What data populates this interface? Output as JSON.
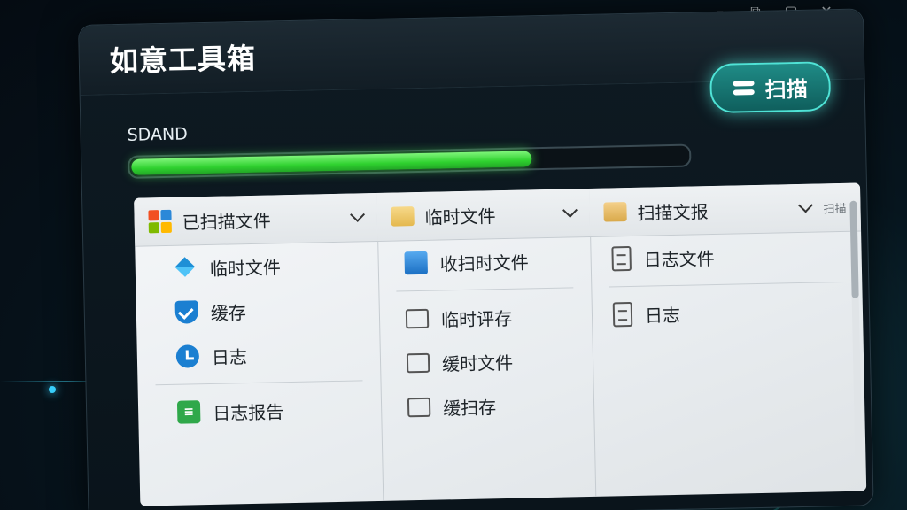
{
  "app": {
    "title": "如意工具箱",
    "scan_button_label": "扫描",
    "drive_label": "SDAND",
    "progress_percent": 72
  },
  "window_controls": [
    "minimize-icon",
    "restore-icon",
    "maximize-icon",
    "close-icon"
  ],
  "columns": [
    {
      "header": "已扫描文件",
      "items": [
        {
          "label": "临时文件",
          "icon": "diamond-icon"
        },
        {
          "label": "缓存",
          "icon": "shield-check-icon"
        },
        {
          "label": "日志",
          "icon": "clock-icon"
        },
        {
          "label": "日志报告",
          "icon": "green-grid-icon"
        }
      ]
    },
    {
      "header": "临时文件",
      "items": [
        {
          "label": "收扫时文件",
          "icon": "blue-folder-icon"
        },
        {
          "label": "临时评存",
          "icon": "folder-outline-icon"
        },
        {
          "label": "缓时文件",
          "icon": "folder-outline-icon"
        },
        {
          "label": "缓扫存",
          "icon": "folder-outline-icon"
        }
      ]
    },
    {
      "header": "扫描文报",
      "header_extra": "扫描",
      "items": [
        {
          "label": "日志文件",
          "icon": "document-icon"
        },
        {
          "label": "日志",
          "icon": "document-icon"
        }
      ]
    }
  ],
  "colors": {
    "accent": "#4fe3d6",
    "progress": "#2fd12f",
    "window_bg": "#0e1a22",
    "panel_bg": "#eef1f3"
  }
}
